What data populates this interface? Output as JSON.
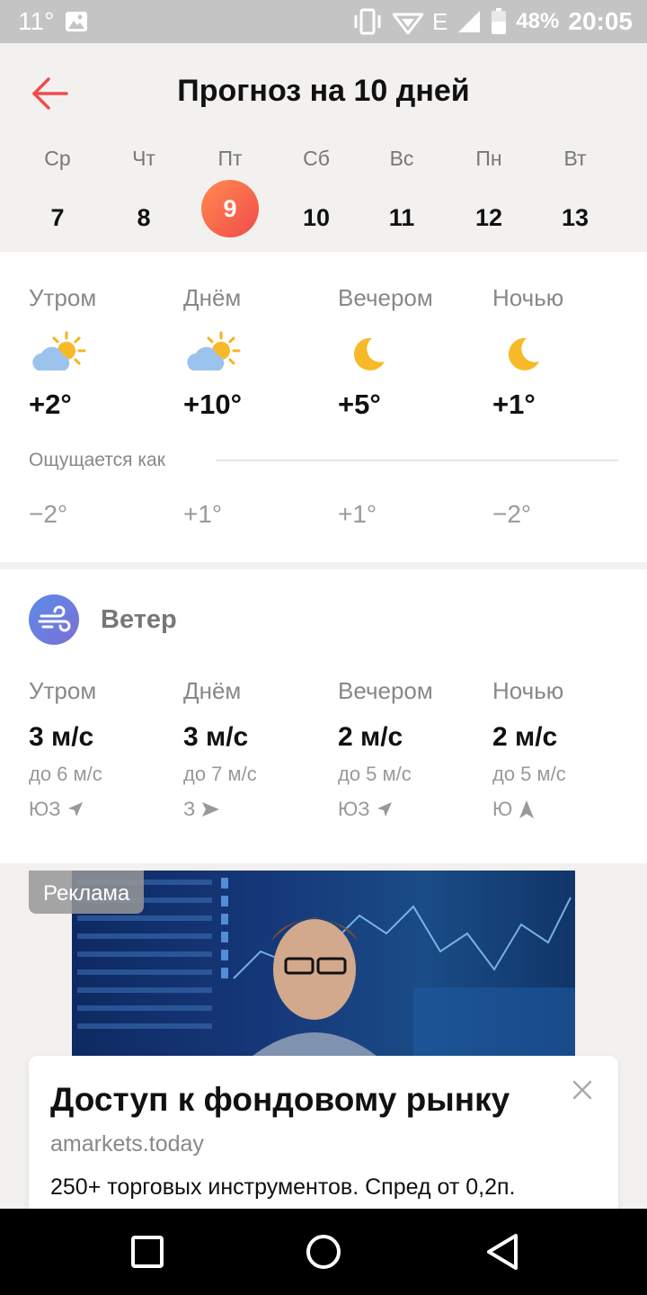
{
  "status_bar": {
    "temperature": "11°",
    "network": "E",
    "battery": "48%",
    "time": "20:05",
    "icons": [
      "image-icon",
      "vibrate-icon",
      "wifi-icon",
      "signal-icon",
      "battery-icon"
    ]
  },
  "header": {
    "title": "Прогноз на 10 дней",
    "back_icon": "arrow-left-icon",
    "accent_color": "#f24b4b",
    "days": [
      {
        "name": "Ср",
        "num": "7"
      },
      {
        "name": "Чт",
        "num": "8"
      },
      {
        "name": "Пт",
        "num": "9",
        "selected": true
      },
      {
        "name": "Сб",
        "num": "10"
      },
      {
        "name": "Вс",
        "num": "11"
      },
      {
        "name": "Пн",
        "num": "12"
      },
      {
        "name": "Вт",
        "num": "13"
      }
    ]
  },
  "forecast": {
    "periods": [
      {
        "label": "Утром",
        "icon": "partly-cloudy-icon",
        "temp": "+2°",
        "feels": "−2°"
      },
      {
        "label": "Днём",
        "icon": "partly-cloudy-icon",
        "temp": "+10°",
        "feels": "+1°"
      },
      {
        "label": "Вечером",
        "icon": "moon-icon",
        "temp": "+5°",
        "feels": "+1°"
      },
      {
        "label": "Ночью",
        "icon": "moon-icon",
        "temp": "+1°",
        "feels": "−2°"
      }
    ],
    "feels_label": "Ощущается как"
  },
  "wind": {
    "title": "Ветер",
    "icon": "wind-icon",
    "periods": [
      {
        "label": "Утром",
        "speed": "3 м/с",
        "gust": "до 6 м/с",
        "dir": "ЮЗ",
        "arrow": "northeast-arrow-icon"
      },
      {
        "label": "Днём",
        "speed": "3 м/с",
        "gust": "до 7 м/с",
        "dir": "З",
        "arrow": "east-arrow-icon"
      },
      {
        "label": "Вечером",
        "speed": "2 м/с",
        "gust": "до 5 м/с",
        "dir": "ЮЗ",
        "arrow": "northeast-arrow-icon"
      },
      {
        "label": "Ночью",
        "speed": "2 м/с",
        "gust": "до 5 м/с",
        "dir": "Ю",
        "arrow": "north-arrow-icon"
      }
    ]
  },
  "ad": {
    "badge": "Реклама",
    "title": "Доступ к фондовому рынку",
    "domain": "amarkets.today",
    "text": "250+ торговых инструментов. Спред от 0,2п."
  },
  "nav_bar": {
    "buttons": [
      "recents-button",
      "home-button",
      "back-button"
    ]
  }
}
